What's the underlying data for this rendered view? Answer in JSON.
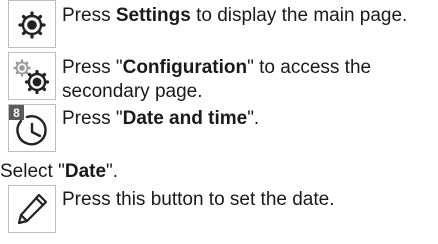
{
  "steps": [
    {
      "icon": "settings-gear-icon",
      "pre": "Press ",
      "bold": "Settings",
      "post": " to display the main page."
    },
    {
      "icon": "configuration-gears-icon",
      "pre": "Press \"",
      "bold": "Configuration",
      "post1": "\" to access the",
      "post2": "secondary page."
    },
    {
      "icon": "date-time-clock-icon",
      "badge": "8",
      "pre": "Press \"",
      "bold": "Date and time",
      "post": "\"."
    },
    {
      "pre": "Select \"",
      "bold": "Date",
      "post": "\"."
    },
    {
      "icon": "pencil-icon",
      "text": "Press this button to set the date."
    }
  ]
}
